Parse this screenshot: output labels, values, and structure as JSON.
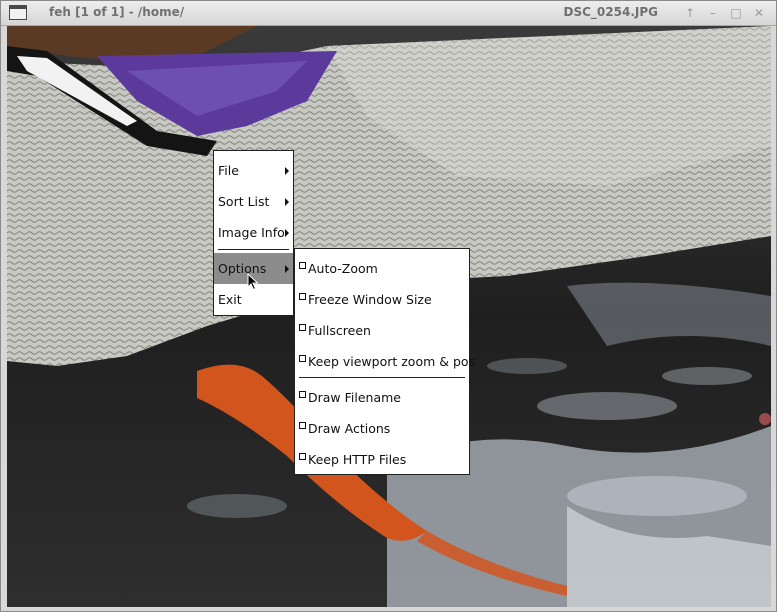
{
  "window": {
    "title_left": "feh [1 of 1] - /home/",
    "title_right": "DSC_0254.JPG",
    "buttons": {
      "up": "↑",
      "minimize": "–",
      "maximize": "□",
      "close": "✕"
    },
    "icon": "app-window-icon"
  },
  "menu": {
    "items": [
      {
        "label": "File",
        "has_submenu": true
      },
      {
        "label": "Sort List",
        "has_submenu": true
      },
      {
        "label": "Image Info",
        "has_submenu": true
      },
      {
        "label": "Options",
        "has_submenu": true,
        "selected": true
      },
      {
        "label": "Exit",
        "has_submenu": false
      }
    ]
  },
  "options_menu": {
    "items": [
      {
        "label": "Auto-Zoom",
        "checked": false
      },
      {
        "label": "Freeze Window Size",
        "checked": false
      },
      {
        "label": "Fullscreen",
        "checked": false
      },
      {
        "label": "Keep viewport zoom & pos",
        "checked": false
      },
      {
        "label": "Draw Filename",
        "checked": false
      },
      {
        "label": "Draw Actions",
        "checked": false
      },
      {
        "label": "Keep HTTP Files",
        "checked": false
      }
    ]
  },
  "image": {
    "icon": "duck-photo",
    "colors": {
      "plumage": "#cfcfc9",
      "purple": "#5b3a9c",
      "water_dark": "#1e1e1e",
      "water_light": "#a9b0b8",
      "orange": "#d2551e",
      "brown": "#5a3a22"
    }
  }
}
